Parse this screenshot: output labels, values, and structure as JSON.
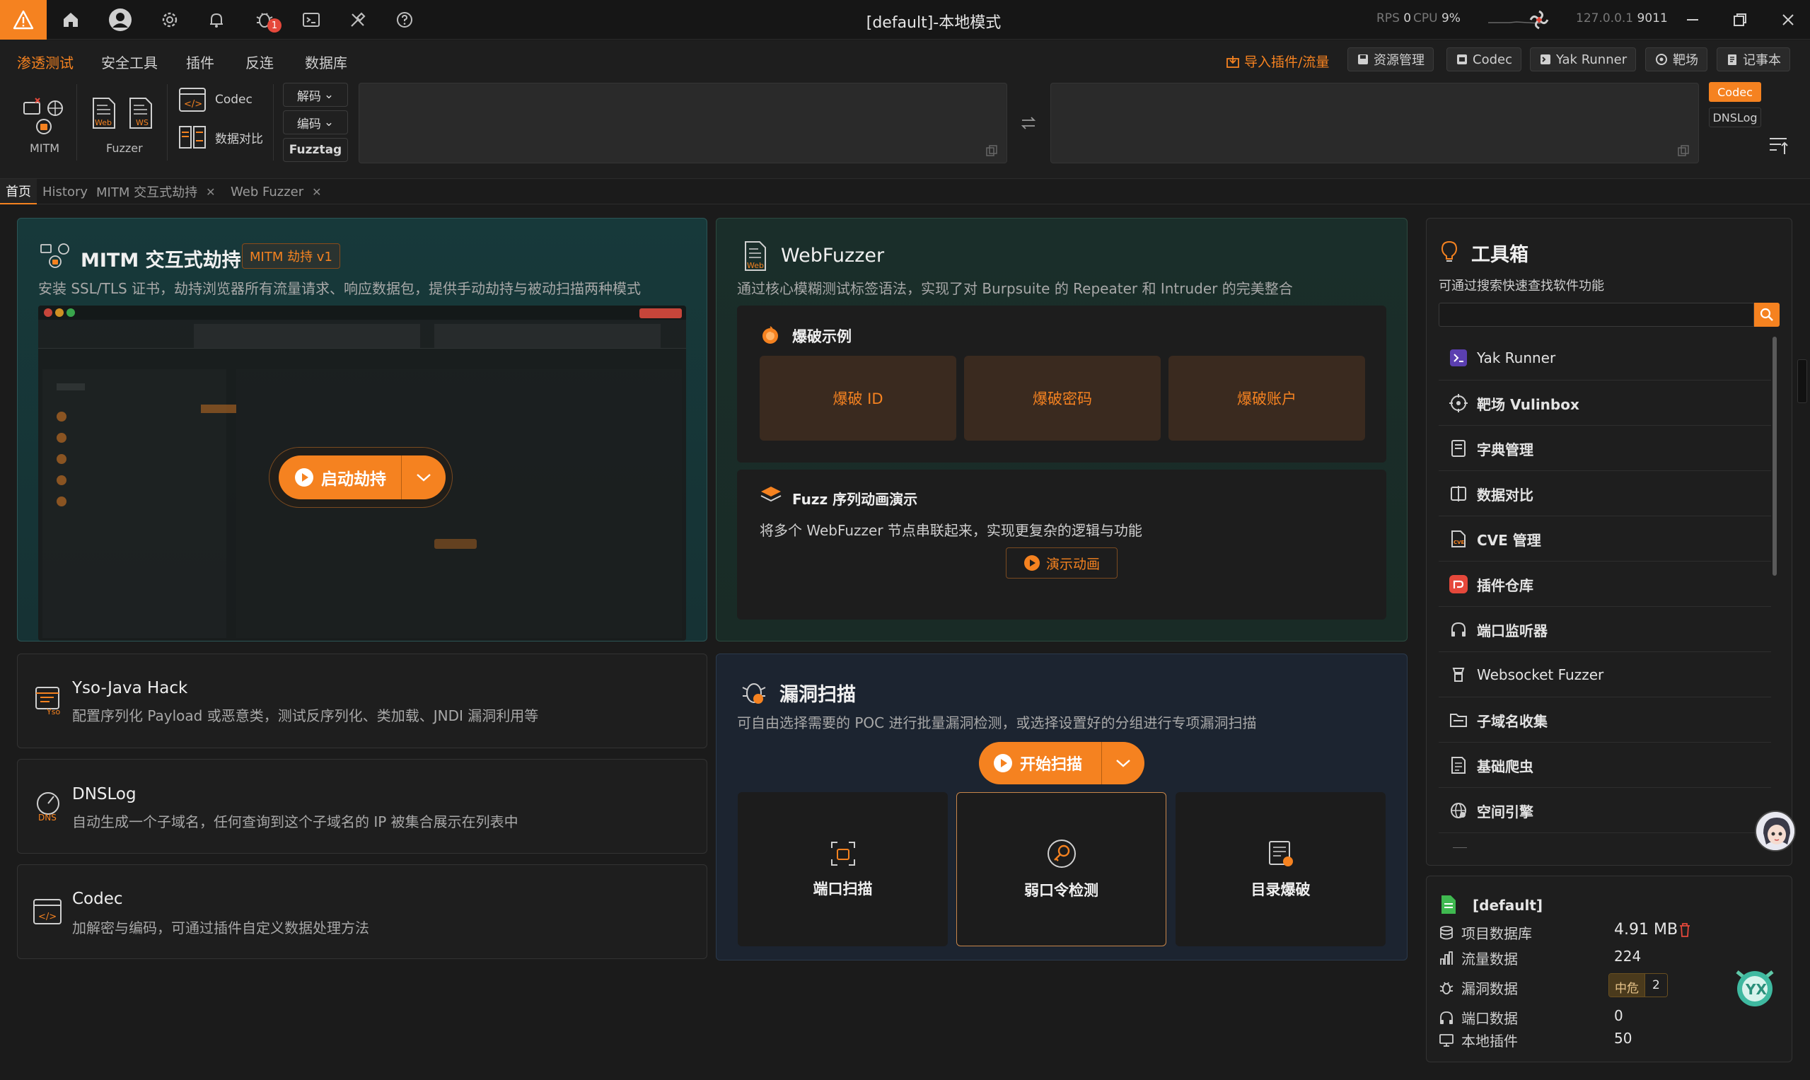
{
  "app": {
    "title": "[default]-本地模式",
    "badge_count": "1",
    "stats": {
      "rps_label": "RPS",
      "rps_value": "0",
      "cpu_label": "CPU",
      "cpu_value": "9%",
      "host": "127.0.0.1",
      "port": "9011"
    }
  },
  "menu": {
    "items": [
      "渗透测试",
      "安全工具",
      "插件",
      "反连",
      "数据库"
    ],
    "active_index": 0,
    "right": {
      "import": "导入插件/流量",
      "resource": "资源管理",
      "codec": "Codec",
      "yak_runner": "Yak Runner",
      "range": "靶场",
      "notebook": "记事本"
    }
  },
  "toolbar": {
    "mitm_label": "MITM",
    "fuzzer_label": "Fuzzer",
    "codec_label": "Codec",
    "compare_label": "数据对比",
    "decode_btn": "解码",
    "encode_btn": "编码",
    "fuzztag_btn": "Fuzztag",
    "side_codec": "Codec",
    "side_dnslog": "DNSLog"
  },
  "tabs": [
    {
      "label": "首页",
      "closable": false,
      "active": true
    },
    {
      "label": "History",
      "closable": false,
      "active": false
    },
    {
      "label": "MITM 交互式劫持",
      "closable": true,
      "active": false
    },
    {
      "label": "Web Fuzzer",
      "closable": true,
      "active": false
    }
  ],
  "mitm_card": {
    "title": "MITM 交互式劫持",
    "tag": "MITM 劫持 v1",
    "desc": "安装 SSL/TLS 证书，劫持浏览器所有流量请求、响应数据包，提供手动劫持与被动扫描两种模式",
    "start_btn": "启动劫持"
  },
  "webfuzzer_card": {
    "title": "WebFuzzer",
    "desc": "通过核心模糊测试标签语法，实现了对 Burpsuite 的 Repeater 和 Intruder 的完美整合",
    "burst_title": "爆破示例",
    "burst_buttons": [
      "爆破 ID",
      "爆破密码",
      "爆破账户"
    ],
    "seq_title": "Fuzz 序列动画演示",
    "seq_desc": "将多个 WebFuzzer 节点串联起来，实现更复杂的逻辑与功能",
    "seq_btn": "演示动画"
  },
  "small_cards": [
    {
      "title": "Yso-Java Hack",
      "desc": "配置序列化 Payload 或恶意类，测试反序列化、类加载、JNDI 漏洞利用等",
      "icon": "yso-icon"
    },
    {
      "title": "DNSLog",
      "desc": "自动生成一个子域名，任何查询到这个子域名的 IP 被集合展示在列表中",
      "icon": "dns-icon"
    },
    {
      "title": "Codec",
      "desc": "加解密与编码，可通过插件自定义数据处理方法",
      "icon": "codec-icon"
    }
  ],
  "vuln_card": {
    "title": "漏洞扫描",
    "desc": "可自由选择需要的 POC 进行批量漏洞检测，或选择设置好的分组进行专项漏洞扫描",
    "start_btn": "开始扫描",
    "tiles": [
      "端口扫描",
      "弱口令检测",
      "目录爆破"
    ]
  },
  "toolbox": {
    "title": "工具箱",
    "subtitle": "可通过搜索快速查找软件功能",
    "search_placeholder": "",
    "items": [
      "Yak Runner",
      "靶场 Vulinbox",
      "字典管理",
      "数据对比",
      "CVE 管理",
      "插件仓库",
      "端口监听器",
      "Websocket Fuzzer",
      "子域名收集",
      "基础爬虫",
      "空间引擎"
    ]
  },
  "project": {
    "name": "[default]",
    "rows": [
      {
        "label": "项目数据库",
        "value": "4.91 MB"
      },
      {
        "label": "流量数据",
        "value": "224"
      },
      {
        "label": "漏洞数据",
        "value": ""
      },
      {
        "label": "端口数据",
        "value": "0"
      },
      {
        "label": "本地插件",
        "value": "50"
      }
    ],
    "vuln_level": "中危",
    "vuln_count": "2"
  },
  "colors": {
    "accent": "#f58220",
    "bg": "#1b1b1b",
    "card": "#1e1e1e",
    "mitm_card": "#17393a",
    "fuzzer_card": "#1a2e27",
    "scan_card": "#1c2430"
  }
}
